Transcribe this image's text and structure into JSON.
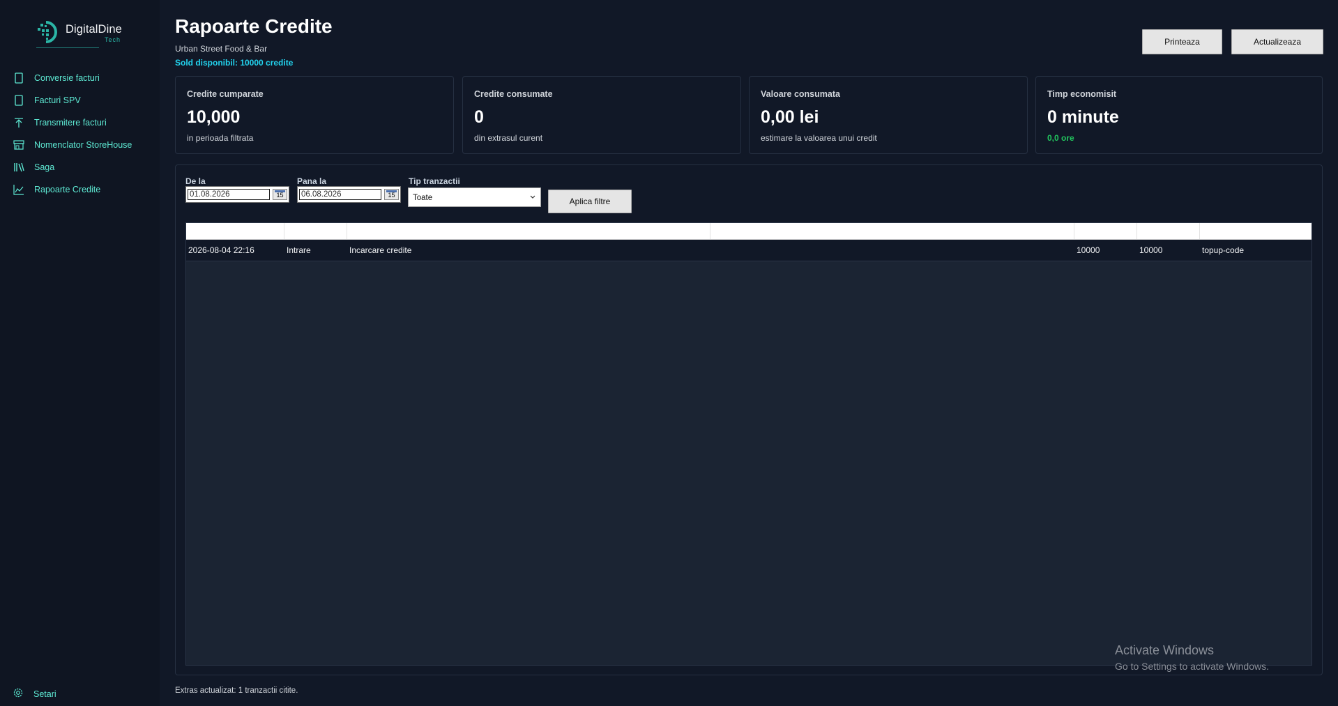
{
  "app": {
    "logo_text": "DigitalDine",
    "logo_sub": "Tech"
  },
  "sidebar": {
    "items": [
      {
        "label": "Conversie facturi",
        "icon": "document-icon"
      },
      {
        "label": "Facturi SPV",
        "icon": "document-icon"
      },
      {
        "label": "Transmitere facturi",
        "icon": "upload-arrow-icon"
      },
      {
        "label": "Nomenclator StoreHouse",
        "icon": "store-icon"
      },
      {
        "label": "Saga",
        "icon": "books-icon"
      },
      {
        "label": "Rapoarte Credite",
        "icon": "chart-icon"
      }
    ],
    "settings_label": "Setari"
  },
  "header": {
    "title": "Rapoarte Credite",
    "subtitle": "Urban Street Food & Bar",
    "balance": "Sold disponibil: 10000 credite",
    "print_label": "Printeaza",
    "refresh_label": "Actualizeaza"
  },
  "cards": [
    {
      "title": "Credite cumparate",
      "value": "10,000",
      "note": "in perioada filtrata"
    },
    {
      "title": "Credite consumate",
      "value": "0",
      "note": "din extrasul curent"
    },
    {
      "title": "Valoare consumata",
      "value": "0,00 lei",
      "note": "estimare la valoarea unui credit"
    },
    {
      "title": "Timp economisit",
      "value": "0 minute",
      "note": "0,0 ore"
    }
  ],
  "filters": {
    "from_label": "De la",
    "from_value": "01.08.2026",
    "to_label": "Pana la",
    "to_value": "06.08.2026",
    "calendar_label": "15",
    "type_label": "Tip tranzactii",
    "type_value": "Toate",
    "apply_label": "Aplica filtre"
  },
  "table": {
    "headers": [
      "",
      "",
      "",
      "",
      "",
      "",
      ""
    ],
    "rows": [
      [
        "2026-08-04 22:16",
        "Intrare",
        "Incarcare credite",
        "",
        "10000",
        "10000",
        "topup-code"
      ]
    ]
  },
  "status_text": "Extras actualizat: 1 tranzactii citite.",
  "watermark": {
    "line1": "Activate Windows",
    "line2": "Go to Settings to activate Windows."
  },
  "colors": {
    "background": "#111827",
    "sidebar": "#0f1522",
    "accent": "#5eead4",
    "balance": "#22d3ee",
    "green": "#22c55e"
  }
}
